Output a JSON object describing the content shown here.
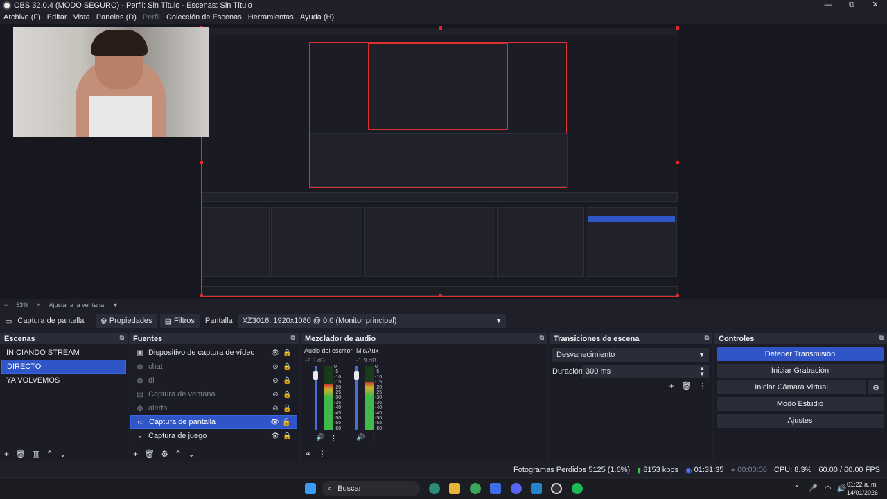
{
  "window": {
    "title": "OBS 32.0.4 (MODO SEGURO) - Perfil: Sin Título - Escenas: Sin Título",
    "controls": [
      "—",
      "⧉",
      "✕"
    ]
  },
  "menu": [
    "Archivo (F)",
    "Editar",
    "Vista",
    "Paneles (D)",
    "Perfil",
    "Colección de Escenas",
    "Herramientas",
    "Ayuda (H)"
  ],
  "zoom": {
    "minus": "−",
    "value": "53%",
    "plus": "+",
    "fit": "Ajustar a la ventana"
  },
  "props_bar": {
    "source": "Captura de pantalla",
    "properties": "Propiedades",
    "filters": "Filtros",
    "label": "Pantalla",
    "value": "XZ3016: 1920x1080 @ 0.0 (Monitor principal)"
  },
  "scenes": {
    "title": "Escenas",
    "items": [
      "INICIANDO STREAM",
      "DIRECTO",
      "YA VOLVEMOS"
    ],
    "selected": 1
  },
  "sources": {
    "title": "Fuentes",
    "items": [
      {
        "label": "Dispositivo de captura de vídeo",
        "icon": "camera-icon",
        "visible": true
      },
      {
        "label": "chat",
        "icon": "globe-icon",
        "visible": false
      },
      {
        "label": "di",
        "icon": "globe-icon",
        "visible": false
      },
      {
        "label": "Captura de ventana",
        "icon": "window-icon",
        "visible": false
      },
      {
        "label": "alerta",
        "icon": "globe-icon",
        "visible": false
      },
      {
        "label": "Captura de pantalla",
        "icon": "monitor-icon",
        "visible": true
      },
      {
        "label": "Captura de juego",
        "icon": "gamepad-icon",
        "visible": true
      }
    ],
    "selected": 5
  },
  "mixer": {
    "title": "Mezclador de audio",
    "channels": [
      {
        "name": "Audio del escritorio",
        "db": "-2.3 dB",
        "level": 0.72
      },
      {
        "name": "Mic/Aux",
        "db": "-1.9 dB",
        "level": 0.75
      }
    ],
    "scale": [
      "0",
      "-5",
      "-10",
      "-15",
      "-20",
      "-25",
      "-30",
      "-35",
      "-40",
      "-45",
      "-50",
      "-55",
      "-60"
    ]
  },
  "transitions": {
    "title": "Transiciones de escena",
    "selected": "Desvanecimiento",
    "duration_label": "Duración",
    "duration_value": "300 ms"
  },
  "controls": {
    "title": "Controles",
    "buttons": [
      "Detener Transmisión",
      "Iniciar Grabación",
      "Iniciar Cámara Virtual",
      "Modo Estudio",
      "Ajustes"
    ]
  },
  "status": {
    "dropped": "Fotogramas Perdidos 5125 (1.6%)",
    "bitrate": "8153 kbps",
    "live_time": "01:31:35",
    "rec_time": "00:00:00",
    "cpu": "CPU: 8.3%",
    "fps": "60.00 / 60.00 FPS"
  },
  "taskbar": {
    "search": "Buscar",
    "time": "01:22 a. m.",
    "date": "14/01/2026"
  },
  "colors": {
    "accent": "#2f55c7",
    "selection": "#d93030"
  }
}
